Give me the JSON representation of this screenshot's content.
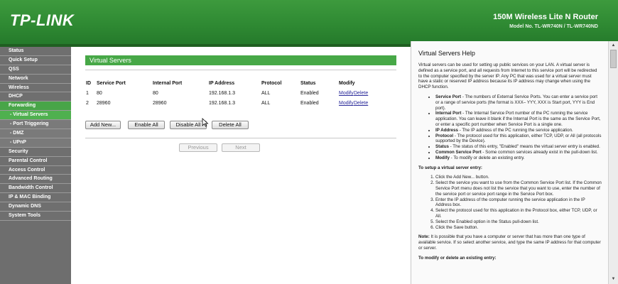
{
  "header": {
    "logo": "TP-LINK",
    "model_title": "150M Wireless Lite N Router",
    "model_no": "Model No. TL-WR740N / TL-WR740ND"
  },
  "sidebar": {
    "items": [
      {
        "label": "Status"
      },
      {
        "label": "Quick Setup"
      },
      {
        "label": "QSS"
      },
      {
        "label": "Network"
      },
      {
        "label": "Wireless"
      },
      {
        "label": "DHCP"
      },
      {
        "label": "Forwarding"
      },
      {
        "label": "- Virtual Servers"
      },
      {
        "label": "- Port Triggering"
      },
      {
        "label": "- DMZ"
      },
      {
        "label": "- UPnP"
      },
      {
        "label": "Security"
      },
      {
        "label": "Parental Control"
      },
      {
        "label": "Access Control"
      },
      {
        "label": "Advanced Routing"
      },
      {
        "label": "Bandwidth Control"
      },
      {
        "label": "IP & MAC Binding"
      },
      {
        "label": "Dynamic DNS"
      },
      {
        "label": "System Tools"
      }
    ]
  },
  "main": {
    "title": "Virtual Servers",
    "table": {
      "headers": [
        "ID",
        "Service Port",
        "Internal Port",
        "IP Address",
        "Protocol",
        "Status",
        "Modify"
      ],
      "rows": [
        {
          "id": "1",
          "service_port": "80",
          "internal_port": "80",
          "ip": "192.168.1.3",
          "protocol": "ALL",
          "status": "Enabled",
          "modify": "Modify",
          "delete": "Delete"
        },
        {
          "id": "2",
          "service_port": "28960",
          "internal_port": "28960",
          "ip": "192.168.1.3",
          "protocol": "ALL",
          "status": "Enabled",
          "modify": "Modify",
          "delete": "Delete"
        }
      ]
    },
    "buttons": {
      "add_new": "Add New...",
      "enable_all": "Enable All",
      "disable_all": "Disable All",
      "delete_all": "Delete All",
      "previous": "Previous",
      "next": "Next"
    }
  },
  "help": {
    "title": "Virtual Servers Help",
    "intro": "Virtual servers can be used for setting up public services on your LAN. A virtual server is defined as a service port, and all requests from Internet to this service port will be redirected to the computer specified by the server IP. Any PC that was used for a virtual server must have a static or reserved IP address because its IP address may change when using the DHCP function.",
    "bullets": [
      {
        "term": "Service Port",
        "text": " - The numbers of External Service Ports. You can enter a service port or a range of service ports (the format is XXX– YYY, XXX is Start port, YYY is End port)."
      },
      {
        "term": "Internal Port",
        "text": " - The Internal Service Port number of the PC running the service application. You can leave it blank if the Internal Port is the same as the Service Port, or enter a specific port number when Service Port is a single one."
      },
      {
        "term": "IP Address",
        "text": " - The IP address of the PC running the service application."
      },
      {
        "term": "Protocol",
        "text": " - The protocol used for this application, either TCP, UDP, or All (all protocols supported by the Device)."
      },
      {
        "term": "Status",
        "text": " - The status of this entry, \"Enabled\" means the virtual server entry is enabled."
      },
      {
        "term": "Common Service Port",
        "text": " - Some common services already exist in the pull-down list."
      },
      {
        "term": "Modify",
        "text": " - To modify or delete an existing entry."
      }
    ],
    "setup_heading": "To setup a virtual server entry:",
    "steps": [
      "Click the Add New... button.",
      "Select the service you want to use from the Common Service Port list. If the Common Service Port menu does not list the service that you want to use, enter the number of the service port or service port range in the Service Port box.",
      "Enter the IP address of the computer running the service application in the IP Address box.",
      "Select the protocol used for this application in the Protocol box, either TCP, UDP, or All.",
      "Select the Enabled option in the Status pull-down list.",
      "Click the Save button."
    ],
    "note_label": "Note:",
    "note": " It is possible that you have a computer or server that has more than one type of available service. If so select another service, and type the same IP address for that computer or server.",
    "modify_heading": "To modify or delete an existing entry:"
  },
  "colors": {
    "header_green": "#2f8a33",
    "active_green": "#48a548",
    "sidebar_gray": "#6f6f6f"
  }
}
